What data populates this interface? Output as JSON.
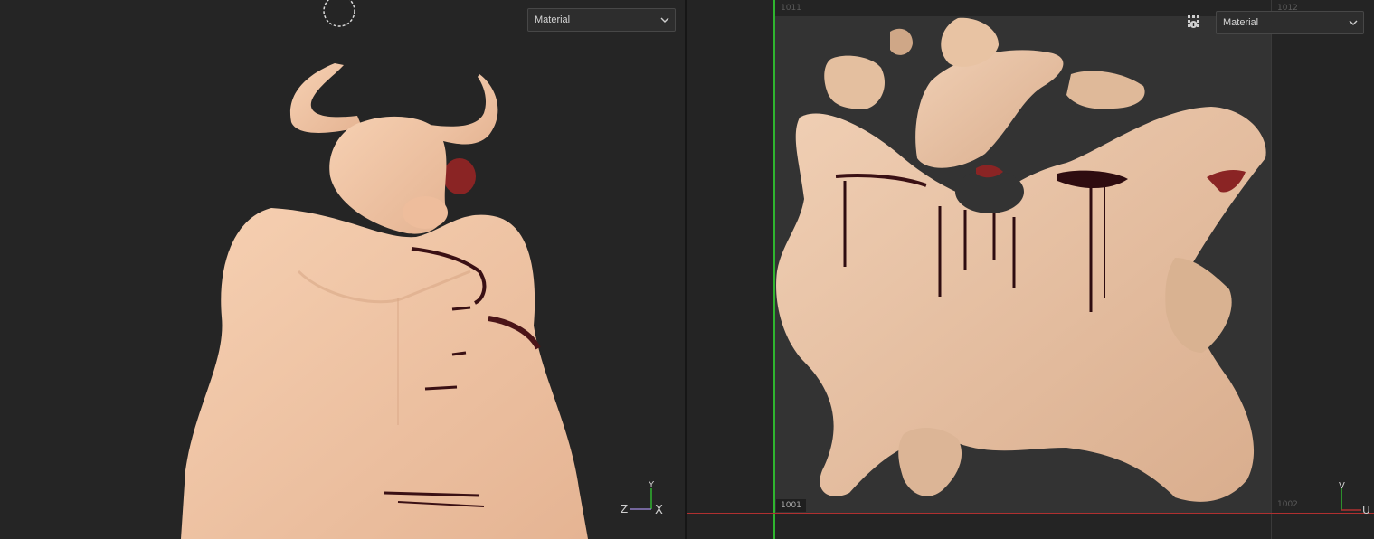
{
  "viewport_3d": {
    "material_select": {
      "value": "Material"
    },
    "axis": {
      "y": "Y",
      "z": "Z",
      "x": "X"
    }
  },
  "viewport_2d": {
    "material_select": {
      "value": "Material"
    },
    "tiles": {
      "t1011": "1011",
      "t1012": "1012",
      "t1001": "1001",
      "t1002": "1002"
    },
    "axis": {
      "v": "V",
      "u": "U"
    }
  },
  "colors": {
    "skin": "#f0c6a6",
    "blood": "#3a1014",
    "green_axis": "#2fb52f",
    "red_axis": "#b03030"
  },
  "icons": [
    "rotate-cursor-icon",
    "chevron-down-icon",
    "display-settings-icon"
  ]
}
